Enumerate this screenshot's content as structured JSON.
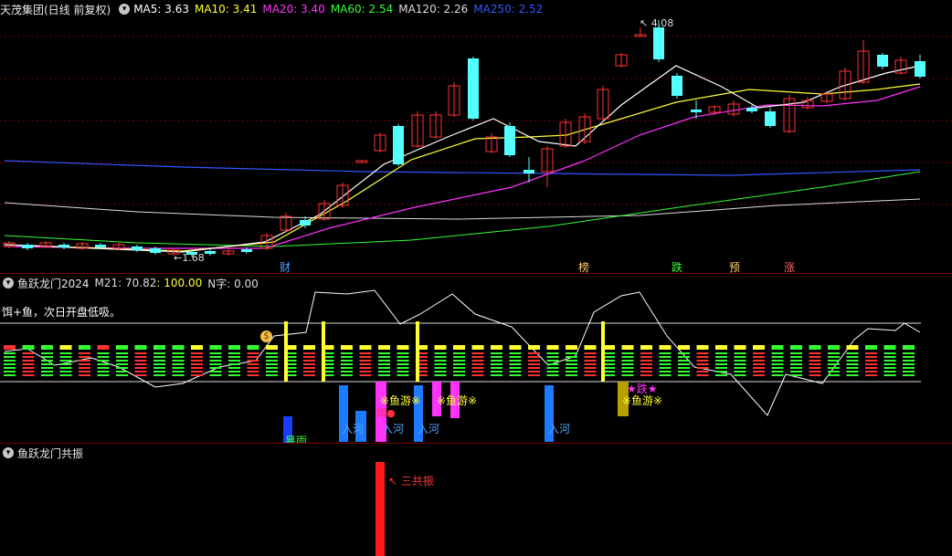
{
  "main_pane": {
    "title": "天茂集团(日线 前复权)",
    "ma": [
      {
        "label": "MA5: 3.63",
        "color": "#ffffff"
      },
      {
        "label": "MA10: 3.41",
        "color": "#ffff33"
      },
      {
        "label": "MA20: 3.40",
        "color": "#ff33ff"
      },
      {
        "label": "MA60: 2.54",
        "color": "#33ff33"
      },
      {
        "label": "MA120: 2.26",
        "color": "#dddddd"
      },
      {
        "label": "MA250: 2.52",
        "color": "#3355ff"
      }
    ],
    "high_label": "4.08",
    "low_label": "1.68",
    "markers": [
      {
        "text": "财",
        "color": "#4da3ff"
      },
      {
        "text": "榜",
        "color": "#ffcc66"
      },
      {
        "text": "跌",
        "color": "#33ff33"
      },
      {
        "text": "预",
        "color": "#ffcc66"
      },
      {
        "text": "涨",
        "color": "#ff6666"
      }
    ]
  },
  "indicator_pane": {
    "title": "鱼跃龙门2024",
    "m21_label": "M21: 70.82",
    "val_label": ": 100.00",
    "n_label": "N字: 0.00",
    "note": "饵+鱼，次日开盘低吸。",
    "bait_label": "饵●",
    "fish_labels": [
      "※鱼游※",
      "※鱼游※",
      "※鱼游※"
    ],
    "star_label": "★跌★",
    "river_labels": [
      "入河",
      "入河",
      "入河",
      "入河"
    ],
    "rain_label": "暴雨"
  },
  "resonance_pane": {
    "title": "鱼跃龙门共振",
    "label": "三共振"
  },
  "colors": {
    "up": "#ff3232",
    "down": "#54ffff",
    "bg": "#000000",
    "grid": "#7a0000",
    "ma5": "#ffffff",
    "ma10": "#ffff33",
    "ma20": "#ff33ff",
    "ma60": "#33ff33",
    "ma120": "#dddddd",
    "ma250": "#3355ff"
  }
}
